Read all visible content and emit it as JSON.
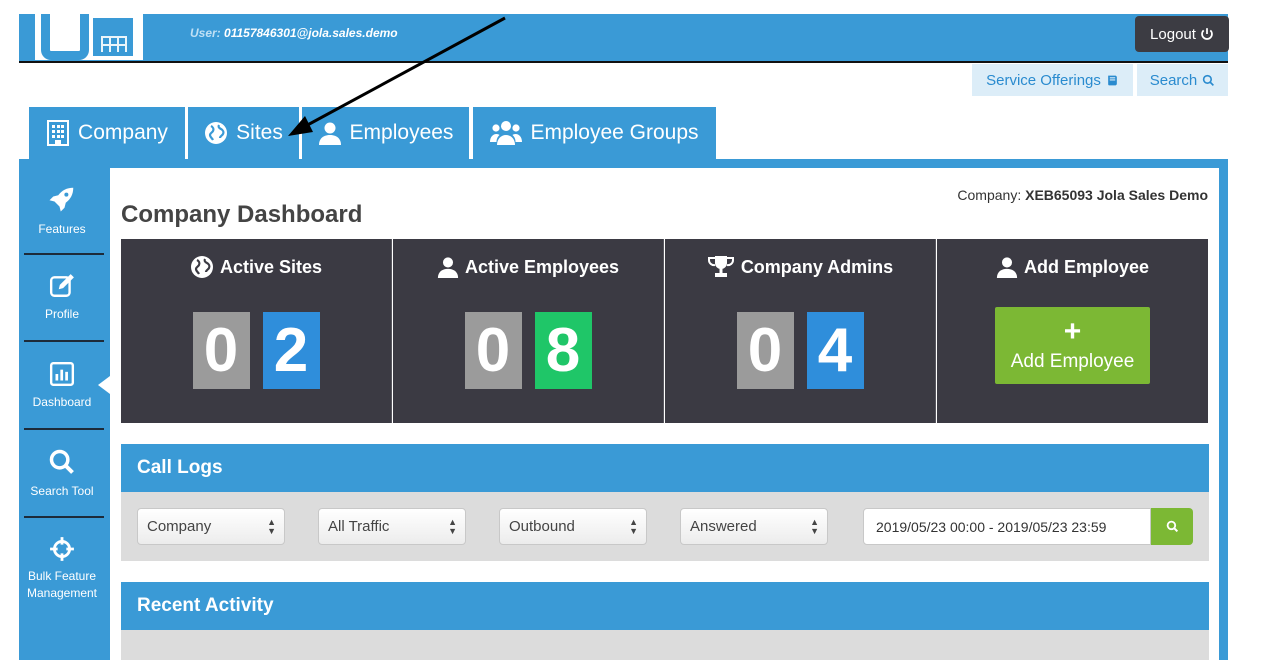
{
  "header": {
    "user_prefix": "User: ",
    "user_email": "01157846301@jola.sales.demo",
    "logout_label": "Logout"
  },
  "subnav": {
    "service_offerings": "Service Offerings",
    "search": "Search"
  },
  "tabs": [
    {
      "label": "Company",
      "icon": "building-icon"
    },
    {
      "label": "Sites",
      "icon": "globe-icon"
    },
    {
      "label": "Employees",
      "icon": "user-icon"
    },
    {
      "label": "Employee Groups",
      "icon": "users-icon"
    }
  ],
  "sidebar": {
    "items": [
      {
        "label": "Features",
        "icon": "rocket-icon"
      },
      {
        "label": "Profile",
        "icon": "edit-icon"
      },
      {
        "label": "Dashboard",
        "icon": "bar-chart-icon"
      },
      {
        "label": "Search Tool",
        "icon": "search-icon"
      },
      {
        "label": "Bulk Feature Management",
        "icon": "crosshair-icon"
      }
    ],
    "active": "Dashboard"
  },
  "company": {
    "prefix": "Company: ",
    "name": "XEB65093 Jola Sales Demo"
  },
  "page_title": "Company Dashboard",
  "stats": [
    {
      "title": "Active Sites",
      "icon": "globe-icon",
      "digits": [
        "0",
        "2"
      ],
      "color": "#2f8edb"
    },
    {
      "title": "Active Employees",
      "icon": "user-icon",
      "digits": [
        "0",
        "8"
      ],
      "color": "#1fc668"
    },
    {
      "title": "Company Admins",
      "icon": "trophy-icon",
      "digits": [
        "0",
        "4"
      ],
      "color": "#2f8edb"
    }
  ],
  "add_employee": {
    "title": "Add Employee",
    "plus": "+",
    "button_label": "Add Employee"
  },
  "call_logs": {
    "title": "Call Logs",
    "filters": [
      "Company",
      "All Traffic",
      "Outbound",
      "Answered"
    ],
    "date_range": "2019/05/23 00:00 - 2019/05/23 23:59"
  },
  "recent_activity": {
    "title": "Recent Activity"
  },
  "colors": {
    "primary": "#3a9ad6",
    "dark_panel": "#3b3a43",
    "digit_grey": "#9b9b9b",
    "accent_green": "#7cb834"
  }
}
